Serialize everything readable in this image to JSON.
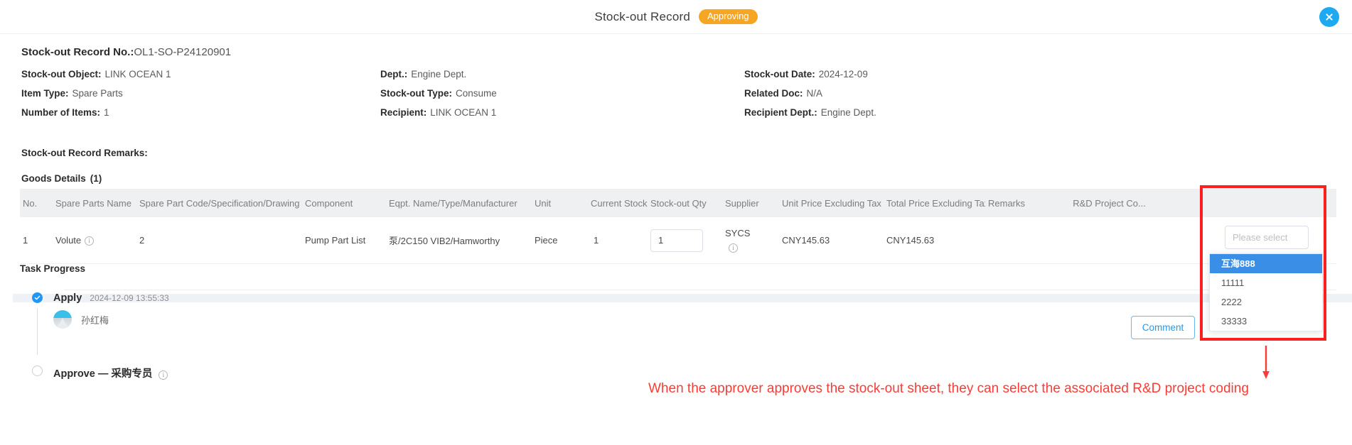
{
  "window": {
    "title": "Stock-out Record",
    "status_badge": "Approving",
    "close_icon": "close-icon"
  },
  "record": {
    "no_label": "Stock-out Record No.:",
    "no_value": "OL1-SO-P24120901",
    "fields": [
      {
        "label": "Stock-out Object:",
        "value": "LINK OCEAN 1"
      },
      {
        "label": "Dept.:",
        "value": "Engine Dept."
      },
      {
        "label": "Stock-out Date:",
        "value": "2024-12-09"
      },
      {
        "label": "Item Type:",
        "value": "Spare Parts"
      },
      {
        "label": "Stock-out Type:",
        "value": "Consume"
      },
      {
        "label": "Related Doc:",
        "value": "N/A"
      },
      {
        "label": "Number of Items:",
        "value": "1"
      },
      {
        "label": "Recipient:",
        "value": "LINK OCEAN 1"
      },
      {
        "label": "Recipient Dept.:",
        "value": "Engine Dept."
      }
    ],
    "remarks_label": "Stock-out Record Remarks:"
  },
  "goods": {
    "title": "Goods Details",
    "count": "(1)",
    "columns": [
      "No.",
      "Spare Parts Name",
      "Spare Part Code/Specification/Drawing No.",
      "Component",
      "Eqpt. Name/Type/Manufacturer",
      "Unit",
      "Current Stock",
      "Stock-out Qty",
      "Supplier",
      "Unit Price Excluding Tax",
      "Total Price Excluding Tax",
      "Remarks",
      "R&D Project Co..."
    ],
    "rows": [
      {
        "no": "1",
        "spare_parts_name": "Volute",
        "spare_part_code": "2",
        "component": "Pump Part List",
        "eqpt": "泵/2C150 VIB2/Hamworthy",
        "unit": "Piece",
        "current_stock": "1",
        "stock_out_qty": "1",
        "supplier": "SYCS",
        "unit_price": "CNY145.63",
        "total_price": "CNY145.63",
        "remarks": ""
      }
    ]
  },
  "rd_select": {
    "placeholder": "Please select",
    "options": [
      "互海888",
      "11111",
      "2222",
      "33333"
    ],
    "selected_index": 0
  },
  "task_progress": {
    "title": "Task Progress",
    "comment_button": "Comment",
    "steps": [
      {
        "name": "Apply",
        "time": "2024-12-09 13:55:33",
        "user": "孙红梅",
        "state": "done"
      },
      {
        "name": "Approve — 采购专员",
        "time": "",
        "user": "",
        "state": "pending"
      }
    ]
  },
  "annotation": {
    "note": "When the approver approves the stock-out sheet, they can select the associated R&D project coding",
    "color": "#fb3b35"
  }
}
